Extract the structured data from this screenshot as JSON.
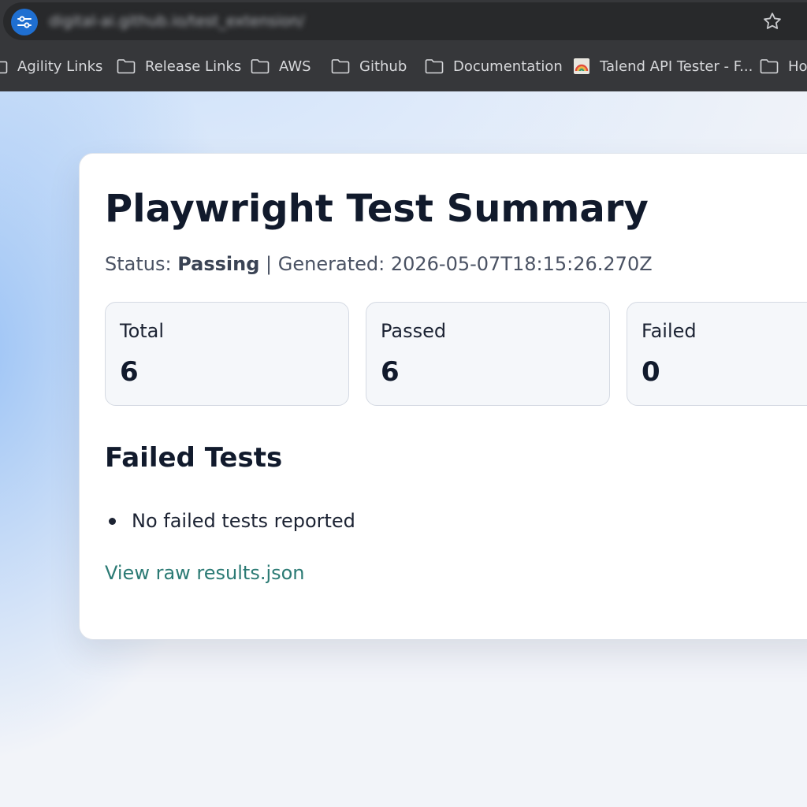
{
  "browser": {
    "url": "digital-ai.github.io/test_extension/",
    "bookmarks": [
      {
        "label": "Agility Links",
        "icon": "folder-icon"
      },
      {
        "label": "Release Links",
        "icon": "folder-icon"
      },
      {
        "label": "AWS",
        "icon": "folder-icon"
      },
      {
        "label": "Github",
        "icon": "folder-icon"
      },
      {
        "label": "Documentation",
        "icon": "folder-icon"
      },
      {
        "label": "Talend API Tester - F...",
        "icon": "talend-icon"
      },
      {
        "label": "Ho",
        "icon": "folder-icon"
      }
    ]
  },
  "summary": {
    "title": "Playwright Test Summary",
    "status_label": "Status:",
    "status_value": "Passing",
    "separator": "|",
    "generated_label": "Generated:",
    "generated_value": "2026-05-07T18:15:26.270Z",
    "stats": [
      {
        "label": "Total",
        "value": "6"
      },
      {
        "label": "Passed",
        "value": "6"
      },
      {
        "label": "Failed",
        "value": "0"
      }
    ],
    "failed_section_title": "Failed Tests",
    "failed_items": [
      "No failed tests reported"
    ],
    "raw_link_label": "View raw results.json"
  },
  "colors": {
    "chrome_bg": "#36373a",
    "omnibox_bg": "#28292b",
    "site_icon_bg": "#1f6fd1",
    "title_text": "#111a2c",
    "link": "#2b7a74"
  }
}
